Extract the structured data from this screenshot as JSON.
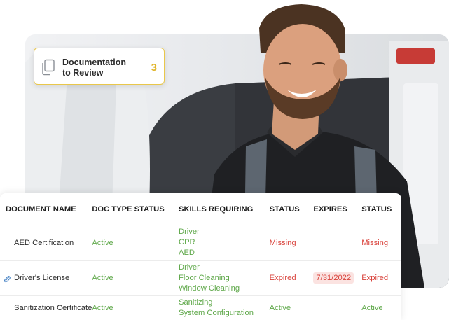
{
  "review_card": {
    "label_line1": "Documentation",
    "label_line2": "to Review",
    "count": "3"
  },
  "table": {
    "headers": [
      "DOCUMENT NAME",
      "DOC TYPE STATUS",
      "SKILLS REQUIRING",
      "STATUS",
      "EXPIRES",
      "STATUS"
    ],
    "rows": [
      {
        "name": "AED Certification",
        "doc_type_status": "Active",
        "skills": [
          "Driver",
          "CPR",
          "AED"
        ],
        "status": "Missing",
        "expires": "",
        "status2": "Missing"
      },
      {
        "name": "Driver's License",
        "doc_type_status": "Active",
        "skills": [
          "Driver",
          "Floor Cleaning",
          "Window Cleaning"
        ],
        "status": "Expired",
        "expires": "7/31/2022",
        "status2": "Expired"
      },
      {
        "name": "Sanitization Certificate",
        "doc_type_status": "Active",
        "skills": [
          "Sanitizing",
          "System Configuration"
        ],
        "status": "Active",
        "expires": "",
        "status2": "Active"
      }
    ]
  },
  "colors": {
    "accent_yellow": "#e0b52a",
    "active_green": "#5fa84a",
    "alert_red": "#d9413a"
  },
  "icons": {
    "review_card": "documents-icon",
    "attachment": "paperclip-icon"
  }
}
